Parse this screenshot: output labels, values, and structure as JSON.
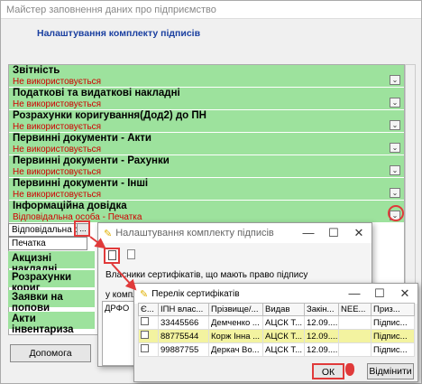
{
  "main_window": {
    "title": "Майстер заповнення даних про підприємство",
    "header": "Налаштування комплекту підписів",
    "help_label": "Допомога"
  },
  "sections": [
    {
      "title": "Звітність",
      "status": "Не використовується"
    },
    {
      "title": "Податкові та видаткові накладні",
      "status": "Не використовується"
    },
    {
      "title": "Розрахунки коригування(Дод2) до ПН",
      "status": "Не використовується"
    },
    {
      "title": "Первинні документи - Акти",
      "status": "Не використовується"
    },
    {
      "title": "Первинні документи - Рахунки",
      "status": "Не використовується"
    },
    {
      "title": "Первинні документи - Інші",
      "status": "Не використовується"
    },
    {
      "title": "Інформаційна довідка",
      "status": "Відповідальна особа - Печатка"
    }
  ],
  "expanded": {
    "field1": "Відповідальна о",
    "field2": "Печатка"
  },
  "lower_sections": [
    "Акцизні накладні",
    "Розрахунки кориг",
    "Заявки на попови",
    "Акти інвентариза"
  ],
  "signature_window": {
    "title": "Налаштування комплекту підписів",
    "info": "Власники сертифікатів, що мають право підпису",
    "info2": "у компл",
    "col_drfo": "ДРФО"
  },
  "cert_window": {
    "title": "Перелік сертифікатів",
    "columns": [
      "Є...",
      "ІПН влас...",
      "Прізвище/...",
      "Видав",
      "Закін...",
      "NEE...",
      "Приз..."
    ],
    "rows": [
      {
        "check": "",
        "ipn": "33445566",
        "name": "Демченко ...",
        "issuer": "АЦСК Т...",
        "date": "12.09....",
        "nee": "",
        "purpose": "Підпис..."
      },
      {
        "check": "",
        "ipn": "88775544",
        "name": "Корж Інна ...",
        "issuer": "АЦСК Т...",
        "date": "12.09....",
        "nee": "",
        "purpose": "Підпис..."
      },
      {
        "check": "",
        "ipn": "99887755",
        "name": "Деркач Во...",
        "issuer": "АЦСК Т...",
        "date": "12.09....",
        "nee": "",
        "purpose": "Підпис..."
      }
    ],
    "ok_label": "ОК",
    "cancel_label": "Відмінити"
  },
  "colors": {
    "section_bg": "#9de29d",
    "status_red": "#d00000",
    "accent_red": "#e03a3a",
    "header_blue": "#1a3fa0",
    "row_highlight": "#f3f3a0"
  }
}
